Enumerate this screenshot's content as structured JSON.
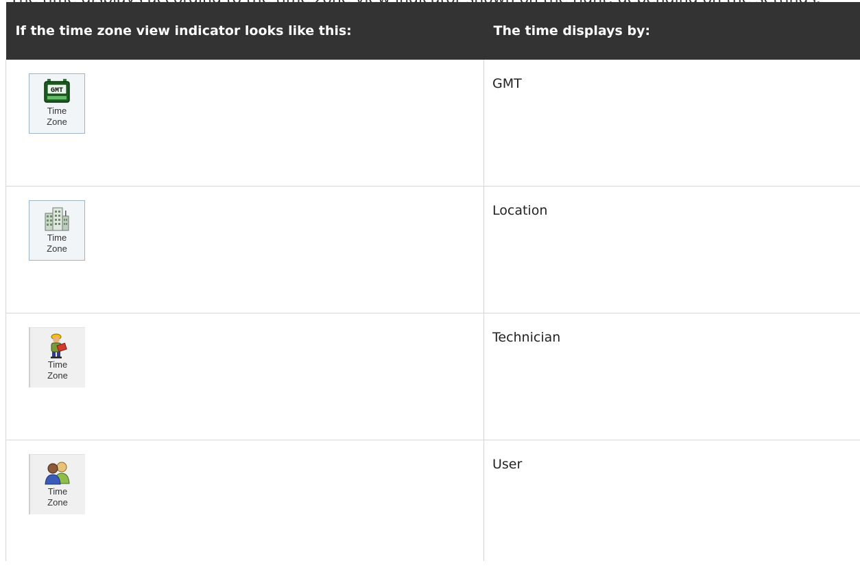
{
  "intro_text": "The time displays according to the time zone view indicator shown on the right, depending on the settings.",
  "table": {
    "headers": [
      "If the time zone view indicator looks like this:",
      "The time displays by:"
    ],
    "rows": [
      {
        "icon": "gmt-clock-icon",
        "icon_text": "GMT",
        "button_label": "Time\nZone",
        "value": "GMT"
      },
      {
        "icon": "building-location-icon",
        "button_label": "Time\nZone",
        "value": "Location"
      },
      {
        "icon": "technician-icon",
        "button_label": "Time\nZone",
        "value": "Technician"
      },
      {
        "icon": "users-icon",
        "button_label": "Time\nZone",
        "value": "User"
      }
    ]
  }
}
